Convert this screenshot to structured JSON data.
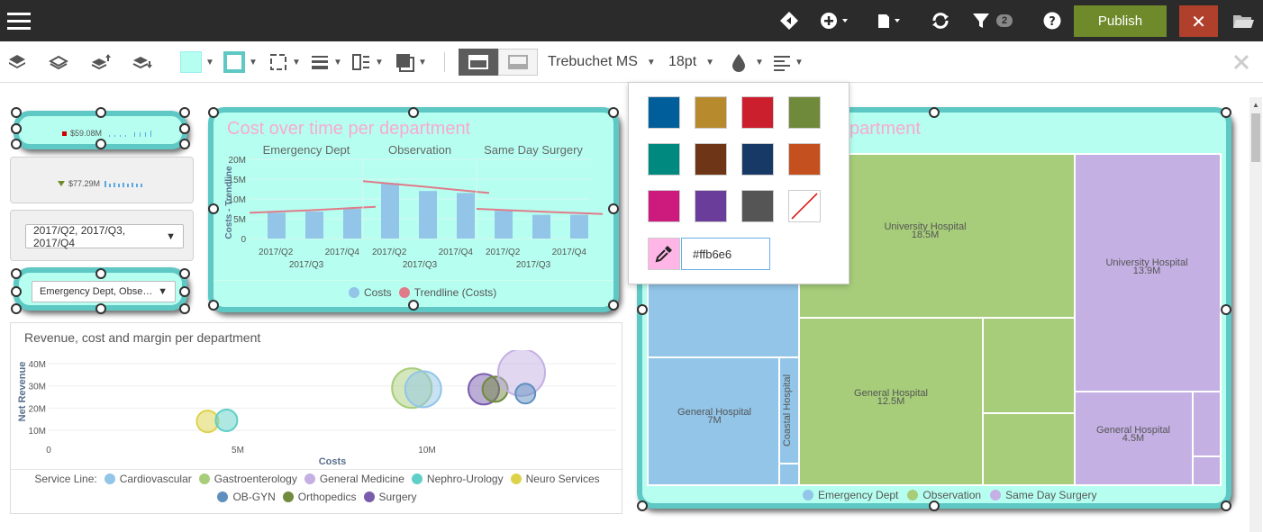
{
  "topbar": {
    "filter_count": "2",
    "publish_label": "Publish",
    "close_label": "✕"
  },
  "toolbar": {
    "font_name": "Trebuchet MS",
    "font_size": "18pt",
    "fill_color": "#b6fff0"
  },
  "kpi1": {
    "value": "$59.08M"
  },
  "kpi2": {
    "value": "$77.29M"
  },
  "filter_quarters": {
    "value": "2017/Q2, 2017/Q3, 2017/Q4"
  },
  "filter_departments": {
    "value": "Emergency Dept, Obse…"
  },
  "cost_chart": {
    "title": "Cost over time per department",
    "legend": [
      "Costs",
      "Trendline (Costs)"
    ],
    "chart_data": {
      "type": "bar",
      "title": "Cost over time per department",
      "ylabel": "Costs - Trendline",
      "ylim": [
        0,
        20
      ],
      "yticks": [
        "20M",
        "15M",
        "10M",
        "5M",
        "0"
      ],
      "panels": [
        {
          "name": "Emergency Dept",
          "categories": [
            "2017/Q2",
            "2017/Q3",
            "2017/Q4"
          ],
          "values": [
            6.5,
            6.8,
            7.5
          ],
          "trend": [
            6.5,
            7.2,
            8.0
          ],
          "xlabels": [
            "2017/Q2",
            "2017/Q4"
          ],
          "sub": "2017/Q3"
        },
        {
          "name": "Observation",
          "categories": [
            "2017/Q2",
            "2017/Q3",
            "2017/Q4"
          ],
          "values": [
            14,
            12,
            11.5
          ],
          "trend": [
            14.5,
            13,
            11.5
          ],
          "xlabels": [
            "2017/Q2",
            "2017/Q4"
          ],
          "sub": "2017/Q3"
        },
        {
          "name": "Same Day Surgery",
          "categories": [
            "2017/Q2",
            "2017/Q3",
            "2017/Q4"
          ],
          "values": [
            7,
            6,
            6
          ],
          "trend": [
            7.5,
            6.8,
            6.2
          ],
          "xlabels": [
            "2017/Q2",
            "2017/Q4"
          ],
          "sub": "2017/Q3"
        }
      ],
      "series": [
        {
          "name": "Costs",
          "color": "#92c5e8"
        },
        {
          "name": "Trendline (Costs)",
          "color": "#e07b8a"
        }
      ]
    }
  },
  "bubble_chart": {
    "title": "Revenue, cost and margin per department",
    "legend_label": "Service Line:",
    "legend_items": [
      {
        "name": "Cardiovascular",
        "color": "#92c5e8"
      },
      {
        "name": "Gastroenterology",
        "color": "#a7cd7a"
      },
      {
        "name": "General Medicine",
        "color": "#c4b0e3"
      },
      {
        "name": "Nephro-Urology",
        "color": "#5fcfc7"
      },
      {
        "name": "Neuro Services",
        "color": "#dcd34a"
      },
      {
        "name": "OB-GYN",
        "color": "#5f8fbf"
      },
      {
        "name": "Orthopedics",
        "color": "#708a3e"
      },
      {
        "name": "Surgery",
        "color": "#7a5cad"
      }
    ],
    "chart_data": {
      "type": "scatter",
      "title": "Revenue, cost and margin per department",
      "xlabel": "Costs",
      "ylabel": "Net Revenue",
      "xlim": [
        0,
        15
      ],
      "ylim": [
        8,
        42
      ],
      "xticks": [
        "0",
        "5M",
        "10M"
      ],
      "yticks": [
        "40M",
        "30M",
        "20M",
        "10M"
      ],
      "points": [
        {
          "x": 4.2,
          "y": 14,
          "r": 12,
          "color": "#dcd34a"
        },
        {
          "x": 4.7,
          "y": 14.5,
          "r": 12,
          "color": "#5fcfc7"
        },
        {
          "x": 9.6,
          "y": 29,
          "r": 22,
          "color": "#a7cd7a"
        },
        {
          "x": 9.9,
          "y": 28.5,
          "r": 20,
          "color": "#92c5e8"
        },
        {
          "x": 11.5,
          "y": 28.5,
          "r": 17,
          "color": "#7a5cad"
        },
        {
          "x": 11.8,
          "y": 28.5,
          "r": 14,
          "color": "#708a3e"
        },
        {
          "x": 12.5,
          "y": 36,
          "r": 26,
          "color": "#c4b0e3"
        },
        {
          "x": 12.6,
          "y": 26.5,
          "r": 11,
          "color": "#5f8fbf"
        }
      ]
    }
  },
  "treemap": {
    "title_visible": "partment",
    "legend": [
      {
        "name": "Emergency Dept",
        "color": "#92c5e8"
      },
      {
        "name": "Observation",
        "color": "#a7cd7a"
      },
      {
        "name": "Same Day Surgery",
        "color": "#c4b0e3"
      }
    ],
    "chart_data": {
      "type": "treemap",
      "cells": [
        {
          "label": "University Hospital",
          "value": "18.5M",
          "group": "Observation"
        },
        {
          "label": "General Hospital",
          "value": "12.5M",
          "group": "Observation"
        },
        {
          "label": "University Hospital",
          "value": "13.9M",
          "group": "Same Day Surgery"
        },
        {
          "label": "General Hospital",
          "value": "4.5M",
          "group": "Same Day Surgery"
        },
        {
          "label": "General Hospital",
          "value": "7M",
          "group": "Emergency Dept"
        },
        {
          "label": "Coastal Hospital",
          "value": "",
          "group": "Emergency Dept"
        }
      ]
    }
  },
  "colorpicker": {
    "swatches": [
      "#005f9a",
      "#b88a2e",
      "#cc1f2e",
      "#6f8a3a",
      "#008a7f",
      "#6e3616",
      "#173966",
      "#c4501f",
      "#cc1b7d",
      "#6a3d9a",
      "#555555",
      "none"
    ],
    "hex_value": "#ffb6e6"
  }
}
